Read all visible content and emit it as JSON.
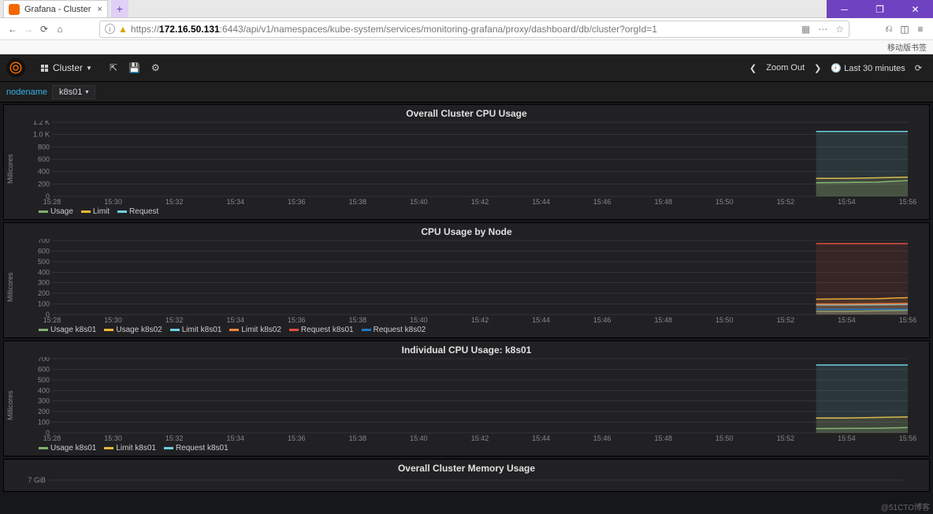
{
  "window": {
    "tab_title": "Grafana - Cluster",
    "url_host": "172.16.50.131",
    "url_rest": ":6443/api/v1/namespaces/kube-system/services/monitoring-grafana/proxy/dashboard/db/cluster?orgId=1",
    "bookmarks_label": "移动版书签"
  },
  "header": {
    "dashboard_name": "Cluster",
    "zoom_out": "Zoom Out",
    "time_range": "Last 30 minutes"
  },
  "vars": {
    "label": "nodename",
    "value": "k8s01"
  },
  "panels": [
    {
      "title": "Overall Cluster CPU Usage",
      "ylabel": "Millicores"
    },
    {
      "title": "CPU Usage by Node",
      "ylabel": "Millicores"
    },
    {
      "title": "Individual CPU Usage: k8s01",
      "ylabel": "Millicores"
    },
    {
      "title": "Overall Cluster Memory Usage",
      "ylabel": ""
    }
  ],
  "x_ticks": [
    "15:28",
    "15:30",
    "15:32",
    "15:34",
    "15:36",
    "15:38",
    "15:40",
    "15:42",
    "15:44",
    "15:46",
    "15:48",
    "15:50",
    "15:52",
    "15:54",
    "15:56"
  ],
  "chart_data": [
    {
      "type": "line",
      "title": "Overall Cluster CPU Usage",
      "xlabel": "",
      "ylabel": "Millicores",
      "x": [
        "15:28",
        "15:30",
        "15:32",
        "15:34",
        "15:36",
        "15:38",
        "15:40",
        "15:42",
        "15:44",
        "15:46",
        "15:48",
        "15:50",
        "15:52",
        "15:54",
        "15:56"
      ],
      "y_ticks": [
        "0",
        "200",
        "400",
        "600",
        "800",
        "1.0 K",
        "1.2 K"
      ],
      "ylim": [
        0,
        1200
      ],
      "series": [
        {
          "name": "Usage",
          "color": "#7eb26d",
          "visible_from": "15:53",
          "values": [
            220,
            225,
            230,
            255
          ]
        },
        {
          "name": "Limit",
          "color": "#eab839",
          "visible_from": "15:53",
          "values": [
            290,
            290,
            300,
            310
          ]
        },
        {
          "name": "Request",
          "color": "#6ed0e0",
          "visible_from": "15:53",
          "values": [
            1050,
            1050,
            1050,
            1050
          ]
        }
      ]
    },
    {
      "type": "line",
      "title": "CPU Usage by Node",
      "xlabel": "",
      "ylabel": "Millicores",
      "x": [
        "15:28",
        "15:30",
        "15:32",
        "15:34",
        "15:36",
        "15:38",
        "15:40",
        "15:42",
        "15:44",
        "15:46",
        "15:48",
        "15:50",
        "15:52",
        "15:54",
        "15:56"
      ],
      "y_ticks": [
        "0",
        "100",
        "200",
        "300",
        "400",
        "500",
        "600",
        "700"
      ],
      "ylim": [
        0,
        700
      ],
      "series": [
        {
          "name": "Usage k8s01",
          "color": "#7eb26d",
          "visible_from": "15:53",
          "values": [
            30,
            30,
            35,
            40
          ]
        },
        {
          "name": "Usage k8s02",
          "color": "#eab839",
          "visible_from": "15:53",
          "values": [
            145,
            148,
            150,
            160
          ]
        },
        {
          "name": "Limit k8s01",
          "color": "#6ed0e0",
          "visible_from": "15:53",
          "values": [
            90,
            90,
            92,
            95
          ]
        },
        {
          "name": "Limit k8s02",
          "color": "#ef843c",
          "visible_from": "15:53",
          "values": [
            100,
            100,
            102,
            105
          ]
        },
        {
          "name": "Request k8s01",
          "color": "#e24d42",
          "visible_from": "15:53",
          "values": [
            670,
            670,
            670,
            670
          ]
        },
        {
          "name": "Request k8s02",
          "color": "#1f78c1",
          "visible_from": "15:53",
          "values": [
            50,
            50,
            50,
            50
          ]
        }
      ]
    },
    {
      "type": "line",
      "title": "Individual CPU Usage: k8s01",
      "xlabel": "",
      "ylabel": "Millicores",
      "x": [
        "15:28",
        "15:30",
        "15:32",
        "15:34",
        "15:36",
        "15:38",
        "15:40",
        "15:42",
        "15:44",
        "15:46",
        "15:48",
        "15:50",
        "15:52",
        "15:54",
        "15:56"
      ],
      "y_ticks": [
        "0",
        "100",
        "200",
        "300",
        "400",
        "500",
        "600",
        "700"
      ],
      "ylim": [
        0,
        700
      ],
      "series": [
        {
          "name": "Usage k8s01",
          "color": "#7eb26d",
          "visible_from": "15:53",
          "values": [
            40,
            42,
            43,
            50
          ]
        },
        {
          "name": "Limit k8s01",
          "color": "#eab839",
          "visible_from": "15:53",
          "values": [
            140,
            140,
            145,
            150
          ]
        },
        {
          "name": "Request k8s01",
          "color": "#6ed0e0",
          "visible_from": "15:53",
          "values": [
            640,
            640,
            640,
            640
          ]
        }
      ]
    },
    {
      "type": "line",
      "title": "Overall Cluster Memory Usage",
      "xlabel": "",
      "ylabel": "",
      "x": [
        "15:28",
        "15:30",
        "15:32",
        "15:34",
        "15:36",
        "15:38",
        "15:40",
        "15:42",
        "15:44",
        "15:46",
        "15:48",
        "15:50",
        "15:52",
        "15:54",
        "15:56"
      ],
      "y_ticks": [
        "7 GiB"
      ],
      "ylim": [
        0,
        8
      ],
      "series": []
    }
  ],
  "watermark": "@51CTO博客"
}
